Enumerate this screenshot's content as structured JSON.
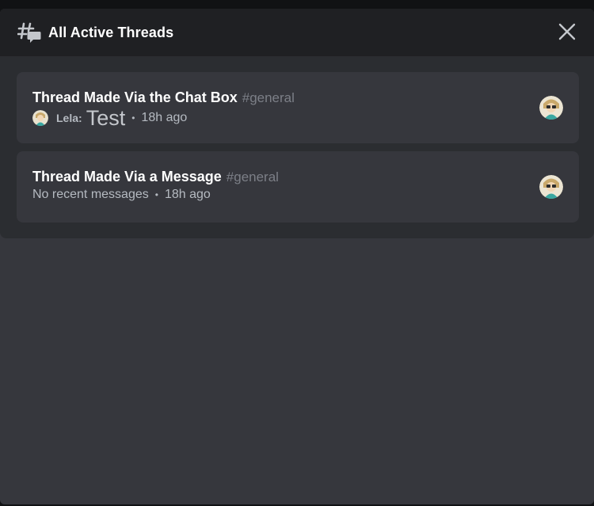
{
  "header": {
    "title": "All Active Threads",
    "icon": "threads-icon",
    "close_icon": "close-icon"
  },
  "threads": [
    {
      "name": "Thread Made Via the Chat Box",
      "channel": "#general",
      "author": "Lela:",
      "preview": "Test",
      "separator": "•",
      "time": "18h ago"
    },
    {
      "name": "Thread Made Via a Message",
      "channel": "#general",
      "preview": "No recent messages",
      "separator": "•",
      "time": "18h ago"
    }
  ],
  "colors": {
    "backdrop": "#111214",
    "header_bg": "#1f2023",
    "list_bg": "#2b2d31",
    "card_bg": "#36373d",
    "text_primary": "#ffffff",
    "text_muted": "#b5bac1",
    "channel_text": "#7c7f87"
  }
}
